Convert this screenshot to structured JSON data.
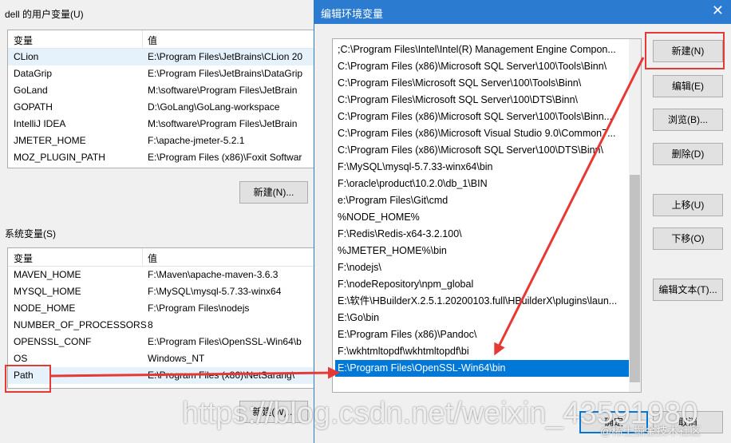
{
  "back_dialog": {
    "user_vars_label": "dell 的用户变量(U)",
    "user_table": {
      "headers": [
        "变量",
        "值"
      ],
      "rows": [
        [
          "CLion",
          "E:\\Program Files\\JetBrains\\CLion 20"
        ],
        [
          "DataGrip",
          "E:\\Program Files\\JetBrains\\DataGrip"
        ],
        [
          "GoLand",
          "M:\\software\\Program Files\\JetBrain"
        ],
        [
          "GOPATH",
          "D:\\GoLang\\GoLang-workspace"
        ],
        [
          "IntelliJ IDEA",
          "M:\\software\\Program Files\\JetBrain"
        ],
        [
          "JMETER_HOME",
          "F:\\apache-jmeter-5.2.1"
        ],
        [
          "MOZ_PLUGIN_PATH",
          "E:\\Program Files (x86)\\Foxit Softwar"
        ]
      ]
    },
    "user_new_button": "新建(N)...",
    "sys_vars_label": "系统变量(S)",
    "sys_table": {
      "headers": [
        "变量",
        "值"
      ],
      "rows": [
        [
          "MAVEN_HOME",
          "F:\\Maven\\apache-maven-3.6.3"
        ],
        [
          "MYSQL_HOME",
          "F:\\MySQL\\mysql-5.7.33-winx64"
        ],
        [
          "NODE_HOME",
          "F:\\Program Files\\nodejs"
        ],
        [
          "NUMBER_OF_PROCESSORS",
          "8"
        ],
        [
          "OPENSSL_CONF",
          "E:\\Program Files\\OpenSSL-Win64\\b"
        ],
        [
          "OS",
          "Windows_NT"
        ],
        [
          "Path",
          "E:\\Program Files (x86)\\NetSarang\\"
        ]
      ]
    },
    "sys_new_button": "新建(W)..."
  },
  "front_dialog": {
    "title": "编辑环境变量",
    "close_glyph": "✕",
    "path_entries": [
      ";C:\\Program Files\\Intel\\Intel(R) Management Engine Compon...",
      "C:\\Program Files (x86)\\Microsoft SQL Server\\100\\Tools\\Binn\\",
      "C:\\Program Files\\Microsoft SQL Server\\100\\Tools\\Binn\\",
      "C:\\Program Files\\Microsoft SQL Server\\100\\DTS\\Binn\\",
      "C:\\Program Files (x86)\\Microsoft SQL Server\\100\\Tools\\Binn...",
      "C:\\Program Files (x86)\\Microsoft Visual Studio 9.0\\Common7...",
      "C:\\Program Files (x86)\\Microsoft SQL Server\\100\\DTS\\Binn\\",
      "F:\\MySQL\\mysql-5.7.33-winx64\\bin",
      "F:\\oracle\\product\\10.2.0\\db_1\\BIN",
      "e:\\Program Files\\Git\\cmd",
      "%NODE_HOME%",
      "F:\\Redis\\Redis-x64-3.2.100\\",
      "%JMETER_HOME%\\bin",
      "F:\\nodejs\\",
      "F:\\nodeRepository\\npm_global",
      "E:\\软件\\HBuilderX.2.5.1.20200103.full\\HBuilderX\\plugins\\laun...",
      "E:\\Go\\bin",
      "E:\\Program Files (x86)\\Pandoc\\",
      "F:\\wkhtmltopdf\\wkhtmltopdf\\bi",
      "E:\\Program Files\\OpenSSL-Win64\\bin"
    ],
    "selected_index": 19,
    "buttons": {
      "new": "新建(N)",
      "edit": "编辑(E)",
      "browse": "浏览(B)...",
      "delete": "删除(D)",
      "move_up": "上移(U)",
      "move_down": "下移(O)",
      "edit_text": "编辑文本(T)...",
      "ok": "确定",
      "cancel": "取消"
    }
  },
  "annotation_color": "#e53935",
  "watermarks": [
    "https://blog.csdn.net/weixin_43591980",
    "@稀土掘金技术社区"
  ]
}
